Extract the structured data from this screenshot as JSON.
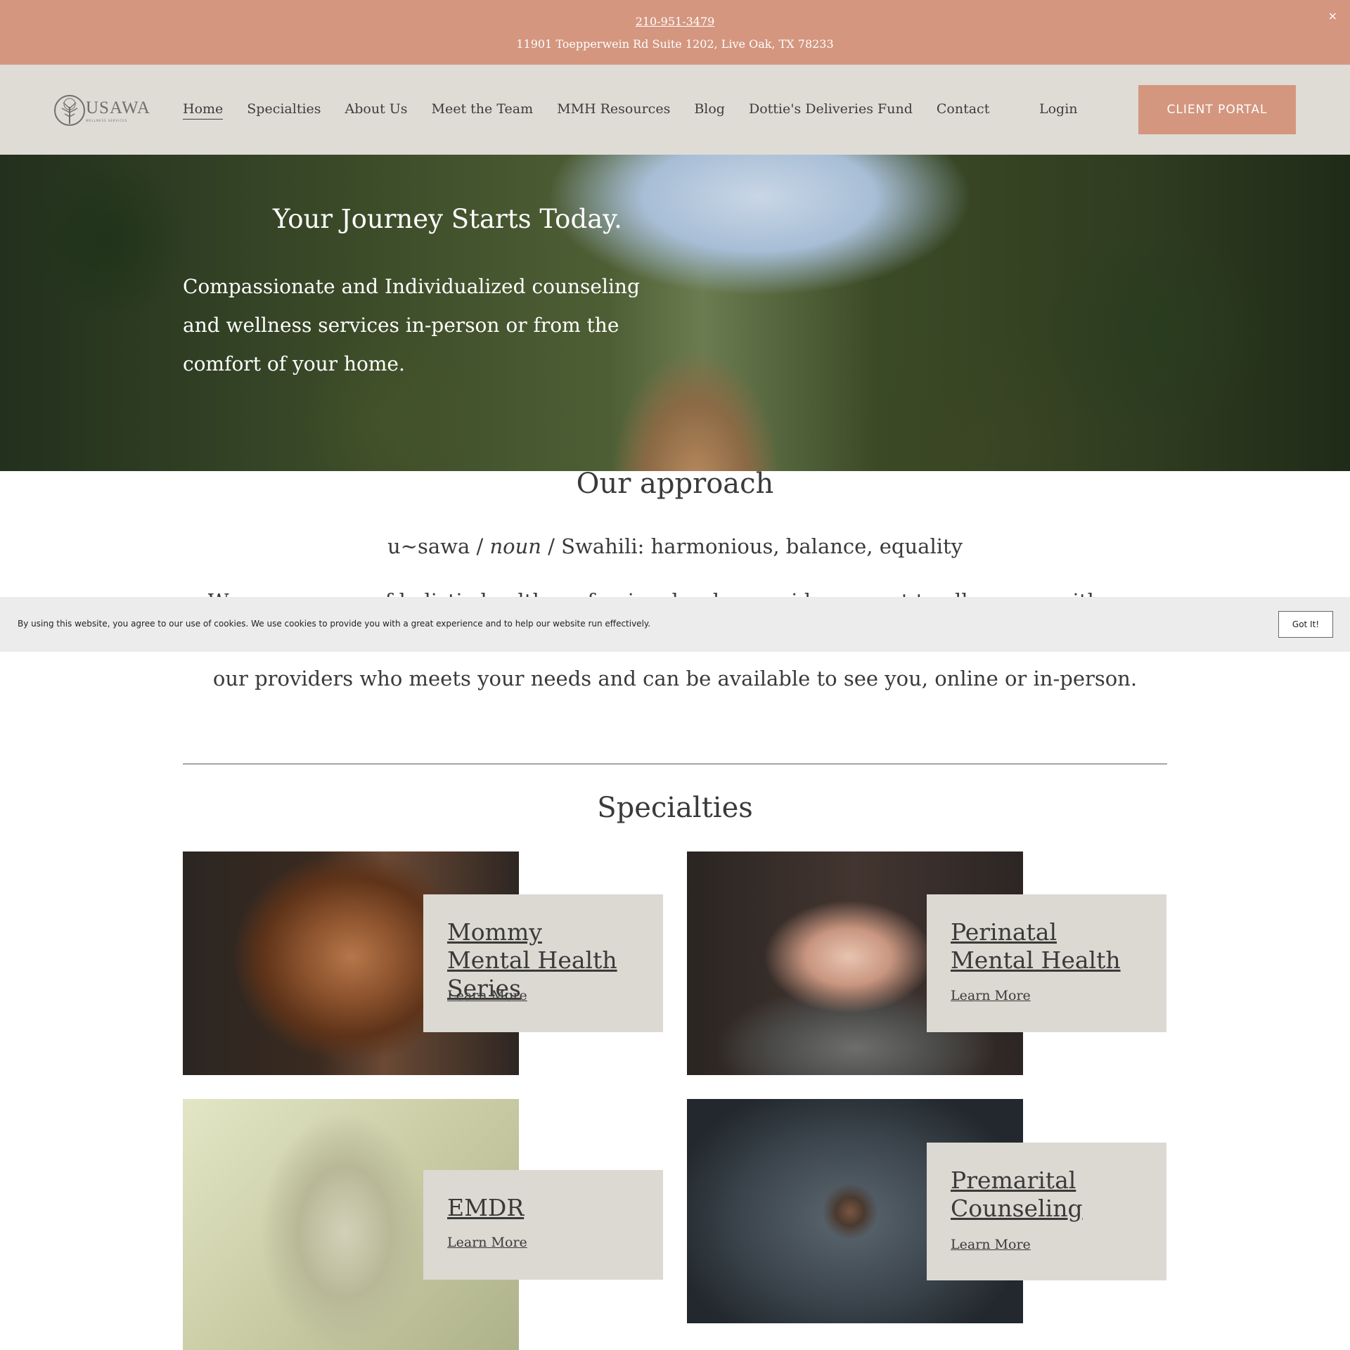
{
  "announcement": {
    "phone": "210-951-3479",
    "address": "11901 Toepperwein Rd Suite 1202, Live Oak, TX 78233",
    "close_label": "×"
  },
  "header": {
    "logo_text": "USAWA",
    "logo_subtext": "WELLNESS SERVICES",
    "nav": [
      "Home",
      "Specialties",
      "About Us",
      "Meet the Team",
      "MMH Resources",
      "Blog",
      "Dottie's Deliveries Fund",
      "Contact"
    ],
    "active_nav": "Home",
    "login_label": "Login",
    "portal_label": "CLIENT PORTAL"
  },
  "hero": {
    "title": "Your Journey Starts Today.",
    "text": "Compassionate and Individualized counseling and wellness services in-person or from the comfort of your home."
  },
  "approach": {
    "title": "Our approach",
    "definition_pre": "u~sawa /",
    "definition_noun": "noun",
    "definition_post": "/ Swahili: harmonious, balance, equality",
    "text_line1": "We are a group of holistic health professionals who provide support to all women with our services",
    "text_rest": "therapy, nutrition counseling, parent coaching, and more. Let us help you connect with one of our providers who meets your needs and can be available to see you, online or in-person."
  },
  "cookie": {
    "message": "By using this website, you agree to our use of cookies. We use cookies to provide you with a great experience and to help our website run effectively.",
    "button_label": "Got It!"
  },
  "specialties": {
    "title": "Specialties",
    "cards": [
      {
        "title": "Mommy Mental Health Series",
        "link": "Learn More"
      },
      {
        "title": "Perinatal Mental Health",
        "link": "Learn More"
      },
      {
        "title": "EMDR",
        "link": "Learn More"
      },
      {
        "title": "Premarital Counseling",
        "link": "Learn More"
      }
    ]
  },
  "colors": {
    "accent": "#d4967f",
    "header_bg": "#dfdcd6",
    "card_bg": "#dcd9d2",
    "text": "#3a3a3a"
  }
}
